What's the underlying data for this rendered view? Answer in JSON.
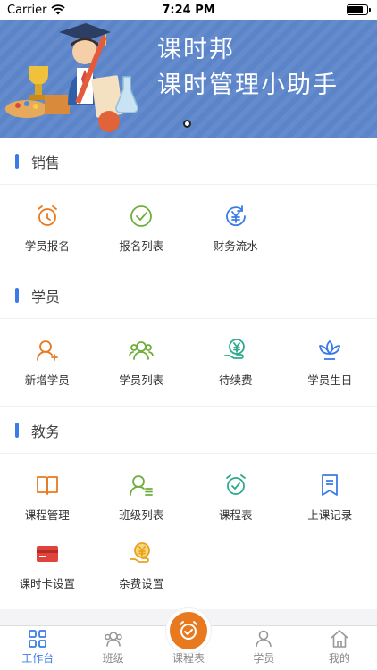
{
  "status_bar": {
    "carrier": "Carrier",
    "time": "7:24 PM"
  },
  "banner": {
    "title": "课时邦",
    "subtitle": "课时管理小助手"
  },
  "colors": {
    "accent": "#3b7be8",
    "orange": "#e8791f",
    "green": "#6fae3c",
    "teal": "#2fa98d",
    "blue": "#3b7be8",
    "red": "#e0433b"
  },
  "sections": [
    {
      "title": "销售",
      "items": [
        {
          "label": "学员报名",
          "icon": "alarm-clock-plus-icon"
        },
        {
          "label": "报名列表",
          "icon": "check-circle-icon"
        },
        {
          "label": "财务流水",
          "icon": "yuan-refresh-icon"
        }
      ]
    },
    {
      "title": "学员",
      "items": [
        {
          "label": "新增学员",
          "icon": "user-add-icon"
        },
        {
          "label": "学员列表",
          "icon": "user-group-icon"
        },
        {
          "label": "待续费",
          "icon": "yuan-hand-icon"
        },
        {
          "label": "学员生日",
          "icon": "lotus-icon"
        }
      ]
    },
    {
      "title": "教务",
      "items": [
        {
          "label": "课程管理",
          "icon": "book-icon"
        },
        {
          "label": "班级列表",
          "icon": "user-list-icon"
        },
        {
          "label": "课程表",
          "icon": "alarm-clock-check-icon"
        },
        {
          "label": "上课记录",
          "icon": "bookmark-icon"
        },
        {
          "label": "课时卡设置",
          "icon": "card-icon"
        },
        {
          "label": "杂费设置",
          "icon": "yuan-hand-icon"
        }
      ]
    }
  ],
  "tabbar": [
    {
      "label": "工作台",
      "icon": "grid-icon",
      "active": true
    },
    {
      "label": "班级",
      "icon": "group-icon",
      "active": false
    },
    {
      "label": "课程表",
      "icon": "alarm-clock-icon",
      "active": false
    },
    {
      "label": "学员",
      "icon": "user-icon",
      "active": false
    },
    {
      "label": "我的",
      "icon": "home-icon",
      "active": false
    }
  ]
}
